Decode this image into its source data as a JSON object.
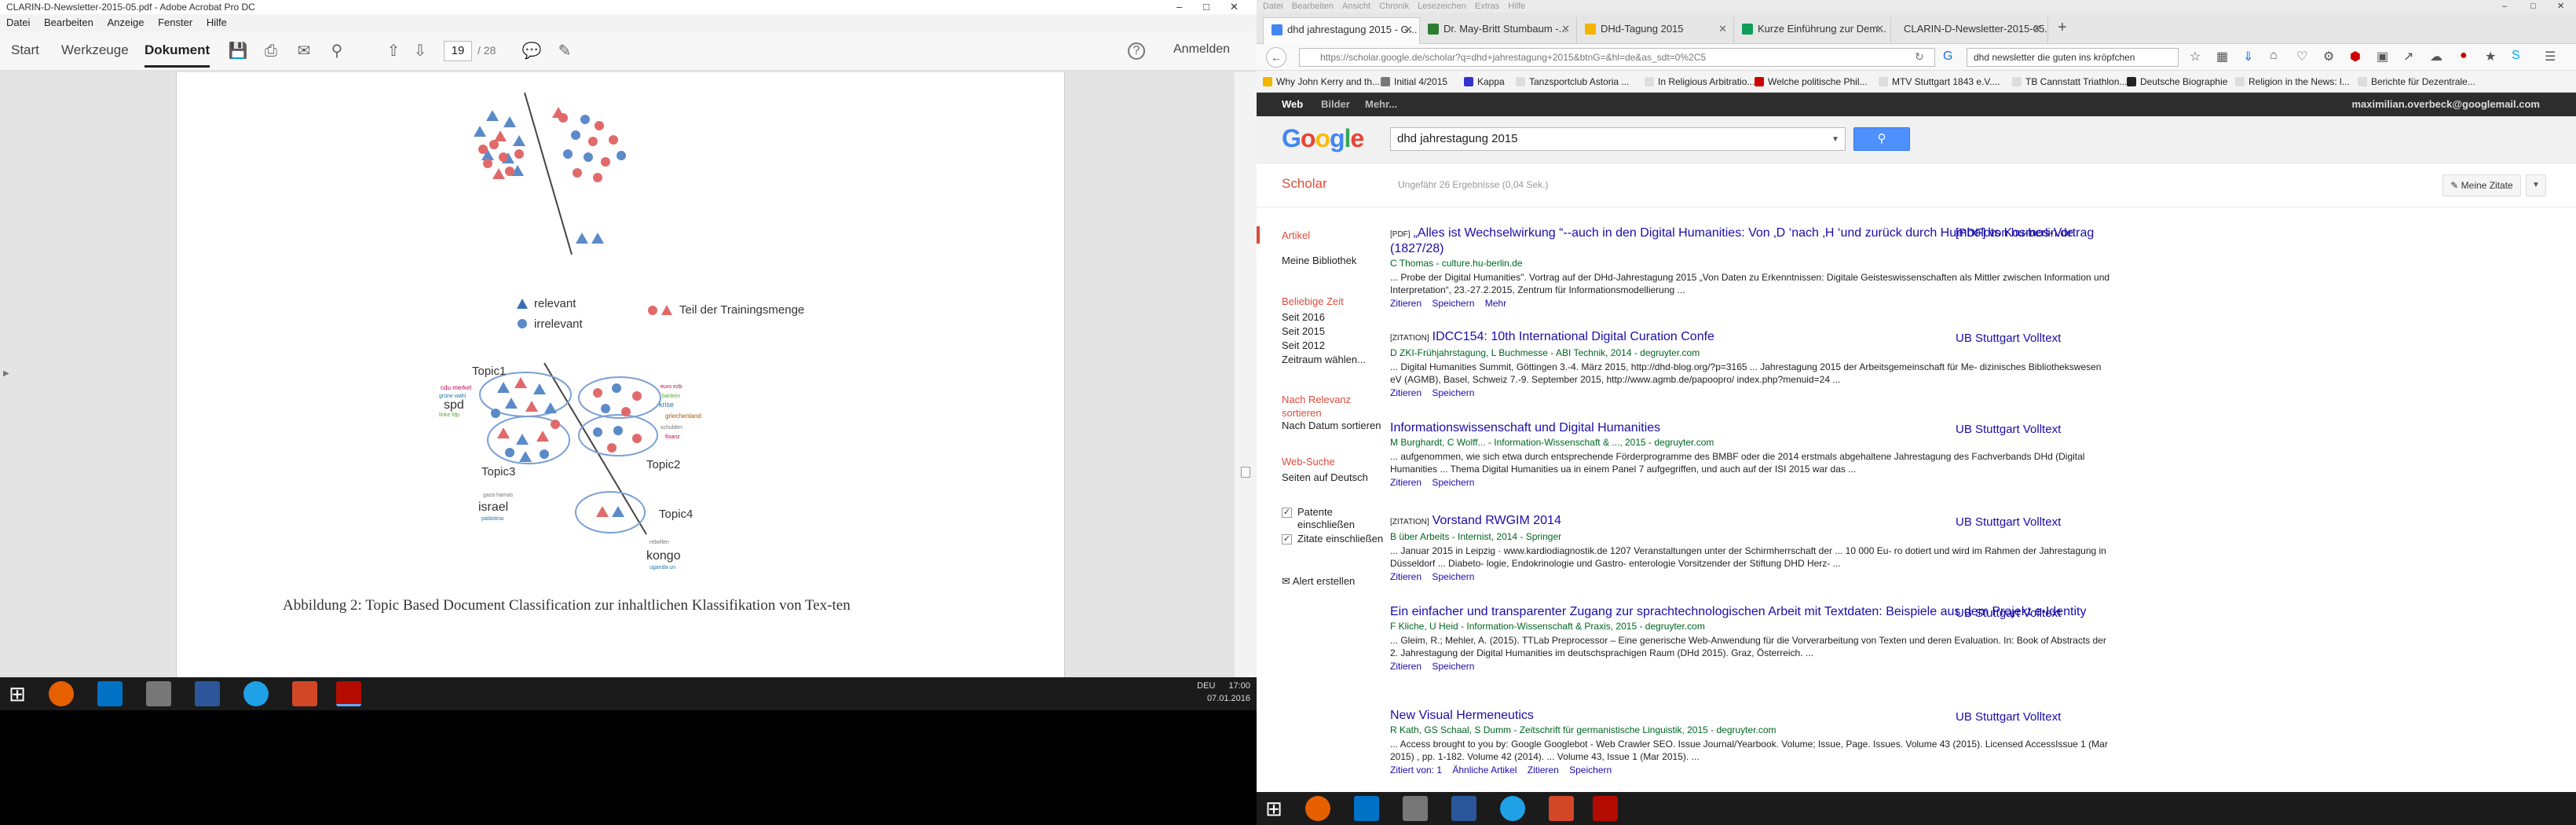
{
  "acrobat": {
    "title": "CLARIN-D-Newsletter-2015-05.pdf - Adobe Acrobat Pro DC",
    "menu": [
      "Datei",
      "Bearbeiten",
      "Anzeige",
      "Fenster",
      "Hilfe"
    ],
    "tabs": [
      "Start",
      "Werkzeuge",
      "Dokument"
    ],
    "active_tab": "Dokument",
    "page_current": "19",
    "page_total": "/ 28",
    "signin": "Anmelden",
    "figure": {
      "legend": {
        "relevant": "relevant",
        "irrelevant": "irrelevant",
        "training": "Teil der Trainingsmenge"
      },
      "topics": [
        "Topic1",
        "Topic2",
        "Topic3",
        "Topic4"
      ],
      "wordcloud_words": [
        "spd",
        "israel",
        "kongo"
      ],
      "colors": {
        "relevant": "#3b6db5",
        "irrelevant": "#5b8ac9",
        "training": "#e06a6a"
      }
    },
    "caption": "Abbildung 2: Topic Based Document Classification zur inhaltlichen Klassifikation von Tex-ten"
  },
  "taskbar": {
    "time": "17:00",
    "date": "07.01.2016",
    "lang": "DEU"
  },
  "firefox": {
    "menu": [
      "Datei",
      "Bearbeiten",
      "Ansicht",
      "Chronik",
      "Lesezeichen",
      "Extras",
      "Hilfe"
    ],
    "tabs": [
      {
        "label": "dhd jahrestagung 2015 - G...",
        "color": "#4285f4",
        "active": true
      },
      {
        "label": "Dr. May-Britt Stumbaum -...",
        "color": "#2e7d32",
        "active": false
      },
      {
        "label": "DHd-Tagung 2015",
        "color": "#f4b400",
        "active": false
      },
      {
        "label": "Kurze Einführung zur Dem...",
        "color": "#0f9d58",
        "active": false
      },
      {
        "label": "CLARIN-D-Newsletter-2015-05...",
        "color": "#999999",
        "active": false
      }
    ],
    "url": "https://scholar.google.de/scholar?q=dhd+jahrestagung+2015&btnG=&hl=de&as_sdt=0%2C5",
    "search_box": "dhd newsletter die guten ins kröpfchen",
    "bookmarks": [
      "Why John Kerry and th...",
      "Initial 4/2015",
      "Kappa",
      "Tanzsportclub Astoria ...",
      "In Religious Arbitratio...",
      "Welche politische Phil...",
      "MTV Stuttgart 1843 e.V....",
      "TB Cannstatt Triathlon...",
      "Deutsche Biographie",
      "Religion in the News: l...",
      "Berichte für Dezentrale..."
    ]
  },
  "scholar": {
    "gbar": {
      "web": "Web",
      "images": "Bilder",
      "more": "Mehr...",
      "account": "maximilian.overbeck@googlemail.com"
    },
    "logo": "Google",
    "query": "dhd jahrestagung 2015",
    "section": "Scholar",
    "stats": "Ungefähr 26 Ergebnisse (0,04 Sek.)",
    "my_citations": "Meine Zitate",
    "sidebar": {
      "articles": "Artikel",
      "library": "Meine Bibliothek",
      "time_head": "Beliebige Zeit",
      "times": [
        "Seit 2016",
        "Seit 2015",
        "Seit 2012",
        "Zeitraum wählen..."
      ],
      "relevance": "Nach Relevanz sortieren",
      "date_sort": "Nach Datum sortieren",
      "web_head": "Web-Suche",
      "german": "Seiten auf Deutsch",
      "patents": "Patente einschließen",
      "citations": "Zitate einschließen",
      "alert": "Alert erstellen"
    },
    "results": [
      {
        "tag": "[PDF]",
        "title": "„Alles ist Wechselwirkung “--auch in den Digital Humanities: Von ‚D ‘nach ‚H ‘und zurück durch Humboldts Kosmos-Vortrag (1827/28)",
        "authors": "C Thomas - culture.hu-berlin.de",
        "snippet": "... Probe der Digital Humanities\". Vortrag auf der DHd-Jahrestagung 2015 „Von Daten zu Erkenntnissen: Digitale Geisteswissenschaften als Mittler zwischen Information und Interpretation“, 23.-27.2.2015, Zentrum für Informationsmodellierung ...",
        "links": [
          "Zitieren",
          "Speichern",
          "Mehr"
        ],
        "side": "[PDF] von hu-berlin.de"
      },
      {
        "tag": "[ZITATION]",
        "title": "IDCC154: 10th International Digital Curation Confe",
        "authors": "D ZKI-Frühjahrstagung, L Buchmesse - ABI Technik, 2014 - degruyter.com",
        "snippet": "... Digital Humanities Summit, Göttingen 3.-4. März 2015, http://dhd-blog.org/?p=3165 ... Jahrestagung 2015 der Arbeitsgemeinschaft für Me- dizinisches Bibliothekswesen eV (AGMB), Basel, Schweiz 7.-9. September 2015, http://www.agmb.de/papoopro/ index.php?menuid=24 ...",
        "links": [
          "Zitieren",
          "Speichern"
        ],
        "side": "UB Stuttgart Volltext"
      },
      {
        "tag": "",
        "title": "Informationswissenschaft und Digital Humanities",
        "authors": "M Burghardt, C Wolff... - Information-Wissenschaft & ..., 2015 - degruyter.com",
        "snippet": "... aufgenommen, wie sich etwa durch entsprechende Förderprogramme des BMBF oder die 2014 erstmals abgehaltene Jahrestagung des Fachverbands DHd (Digital Humanities ... Thema Digital Humanities ua in einem Panel 7 aufgegriffen, und auch auf der ISI 2015 war das ...",
        "links": [
          "Zitieren",
          "Speichern"
        ],
        "side": "UB Stuttgart Volltext"
      },
      {
        "tag": "[ZITATION]",
        "title": "Vorstand RWGIM 2014",
        "authors": "B über Arbeits - Internist, 2014 - Springer",
        "snippet": "... Januar 2015 in Leipzig · www.kardiodiagnostik.de 1207 Veranstaltungen unter der Schirmherrschaft der ... 10 000 Eu- ro dotiert und wird im Rahmen der Jahrestagung in Düsseldorf ... Diabeto- logie, Endokrinologie und Gastro- enterologie Vorsitzender der Stiftung DHD Herz- ...",
        "links": [
          "Zitieren",
          "Speichern"
        ],
        "side": "UB Stuttgart Volltext"
      },
      {
        "tag": "",
        "title": "Ein einfacher und transparenter Zugang zur sprachtechnologischen Arbeit mit Textdaten: Beispiele aus dem Projekt e-Identity",
        "authors": "F Kliche, U Heid - Information-Wissenschaft & Praxis, 2015 - degruyter.com",
        "snippet": "... Gleim, R.; Mehler, A. (2015). TTLab Preprocessor – Eine generische Web-Anwendung für die Vorverarbeitung von Texten und deren Evaluation. In: Book of Abstracts der 2. Jahrestagung der Digital Humanities im deutschsprachigen Raum (DHd 2015). Graz, Österreich. ...",
        "links": [
          "Zitieren",
          "Speichern"
        ],
        "side": "UB Stuttgart Volltext"
      },
      {
        "tag": "",
        "title": "New Visual Hermeneutics",
        "authors": "R Kath, GS Schaal, S Dumm - Zeitschrift für germanistische Linguistik, 2015 - degruyter.com",
        "snippet": "... Access brought to you by: Google Googlebot - Web Crawler SEO. Issue Journal/Yearbook. Volume; Issue, Page. Issues. Volume 43 (2015). Licensed AccessIssue 1 (Mar 2015) , pp. 1-182. Volume 42 (2014). ... Volume 43, Issue 1 (Mar 2015). ...",
        "links": [
          "Zitiert von: 1",
          "Ähnliche Artikel",
          "Zitieren",
          "Speichern"
        ],
        "side": "UB Stuttgart Volltext"
      }
    ]
  }
}
